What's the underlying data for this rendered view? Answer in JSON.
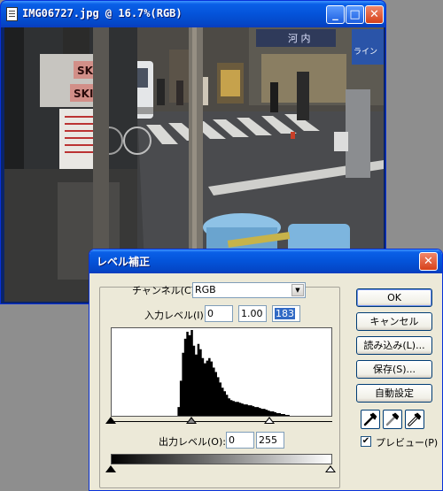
{
  "image_window": {
    "title": "IMG06727.jpg @ 16.7%(RGB)",
    "min_glyph": "_",
    "max_glyph": "□",
    "close_glyph": "✕",
    "photo": {
      "sign_skin_1": "SKIN",
      "sign_skin_2": "SKIN",
      "shop_sign_1": "河 内",
      "shop_sign_2": "ライン"
    }
  },
  "levels_dialog": {
    "title": "レベル補正",
    "close_glyph": "✕",
    "channel": {
      "label": "チャンネル(C):",
      "value": "RGB",
      "arrow": "▼"
    },
    "input_levels": {
      "label": "入力レベル(I):",
      "black": "0",
      "gamma": "1.00",
      "white": "183"
    },
    "output_levels": {
      "label": "出力レベル(O):",
      "black": "0",
      "white": "255"
    },
    "buttons": {
      "ok": "OK",
      "cancel": "キャンセル",
      "load": "読み込み(L)...",
      "save": "保存(S)...",
      "auto": "自動設定"
    },
    "preview": {
      "label": "プレビュー(P)",
      "checked": true,
      "check_glyph": "✔"
    },
    "histogram": [
      0,
      0,
      0,
      0,
      0,
      0,
      0,
      0,
      0,
      0,
      0,
      0,
      0,
      0,
      0,
      0,
      0,
      0,
      0,
      0,
      0,
      0,
      0,
      0,
      0,
      0,
      0,
      0,
      0,
      0,
      10,
      40,
      72,
      88,
      96,
      92,
      98,
      80,
      70,
      82,
      76,
      66,
      60,
      63,
      66,
      62,
      55,
      50,
      44,
      38,
      32,
      28,
      24,
      20,
      18,
      17,
      16,
      16,
      15,
      14,
      13,
      13,
      12,
      12,
      11,
      10,
      10,
      9,
      8,
      8,
      7,
      6,
      5,
      5,
      4,
      3,
      3,
      2,
      2,
      1,
      1,
      0,
      0,
      0,
      0,
      0,
      0,
      0,
      0,
      0,
      0,
      0,
      0,
      0,
      0,
      0,
      0,
      0,
      0,
      0
    ],
    "colors": {
      "titlebar": "#0453d9",
      "face": "#ece9d8",
      "selection": "#316ac5"
    }
  }
}
